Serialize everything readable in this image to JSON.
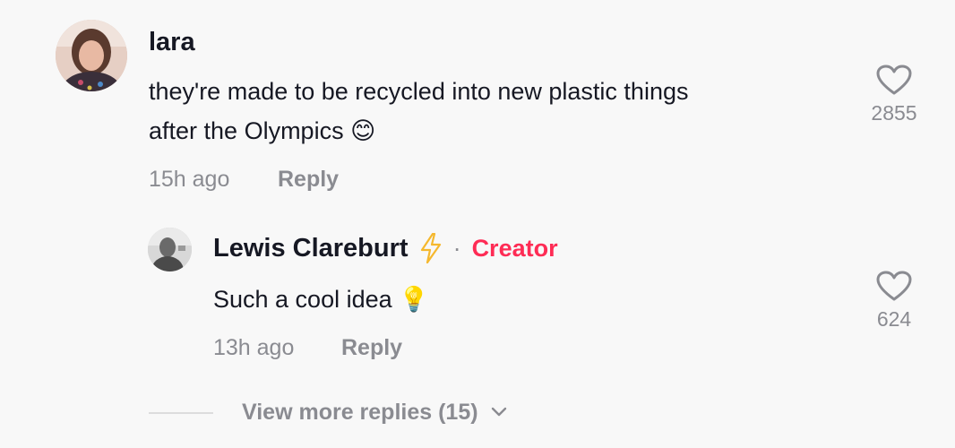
{
  "comment": {
    "username": "lara",
    "text_line1": "they're made to be recycled into new plastic things",
    "text_line2": "after the Olympics",
    "emoji": "😊",
    "timestamp": "15h ago",
    "reply_label": "Reply",
    "like_count": "2855",
    "avatar": "profile-photo-icon"
  },
  "reply": {
    "username": "Lewis Clareburt",
    "badge_icon": "lightning-bolt-icon",
    "separator": "·",
    "creator_label": "Creator",
    "text": "Such a cool idea",
    "emoji": "💡",
    "timestamp": "13h ago",
    "reply_label": "Reply",
    "like_count": "624",
    "avatar": "profile-photo-icon"
  },
  "view_more": {
    "label": "View more replies (15)",
    "icon": "chevron-down-icon"
  },
  "colors": {
    "background": "#f8f8f8",
    "text_primary": "#161823",
    "text_secondary": "#8a8b91",
    "creator_accent": "#fe2c55",
    "bolt": "#f5b82e"
  }
}
